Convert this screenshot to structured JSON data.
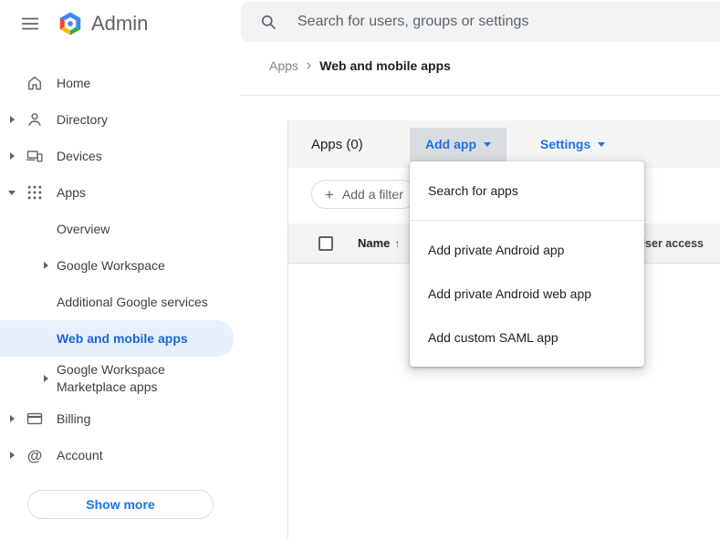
{
  "topbar": {
    "brand": "Admin",
    "search": {
      "placeholder": "Search for users, groups or settings"
    }
  },
  "breadcrumb": {
    "parent": "Apps",
    "separator": "›",
    "current": "Web and mobile apps"
  },
  "sidebar": {
    "items": [
      {
        "label": "Home",
        "icon": "home-icon"
      },
      {
        "label": "Directory",
        "icon": "person-icon"
      },
      {
        "label": "Devices",
        "icon": "devices-icon"
      },
      {
        "label": "Apps",
        "icon": "apps-grid-icon"
      },
      {
        "label": "Billing",
        "icon": "billing-icon"
      },
      {
        "label": "Account",
        "icon": "at-icon"
      }
    ],
    "apps_children": [
      {
        "label": "Overview"
      },
      {
        "label": "Google Workspace"
      },
      {
        "label": "Additional Google services"
      },
      {
        "label": "Web and mobile apps",
        "selected": true
      },
      {
        "label": "Google Workspace Marketplace apps"
      }
    ],
    "show_more_label": "Show more"
  },
  "toolbar": {
    "apps_count": "Apps (0)",
    "add_app_label": "Add app",
    "settings_label": "Settings"
  },
  "filter": {
    "plus": "+",
    "add_filter_label": "Add a filter"
  },
  "table": {
    "name_header": "Name",
    "sort_indicator": "↑",
    "user_access_header": "User access"
  },
  "add_app_menu": {
    "items": [
      {
        "label": "Search for apps"
      },
      {
        "label": "Add private Android app"
      },
      {
        "label": "Add private Android web app"
      },
      {
        "label": "Add custom SAML app"
      }
    ]
  },
  "icons": {
    "at_symbol": "@"
  },
  "colors": {
    "accent_blue": "#1a73e8",
    "selected_item_bg": "#e8f0fe",
    "selected_item_text": "#1967d2",
    "search_bg": "#f1f3f4",
    "toolbar_bg": "#f5f5f5",
    "add_app_pressed_bg": "#d9dce0",
    "table_header_bg": "#f1f3f4"
  }
}
